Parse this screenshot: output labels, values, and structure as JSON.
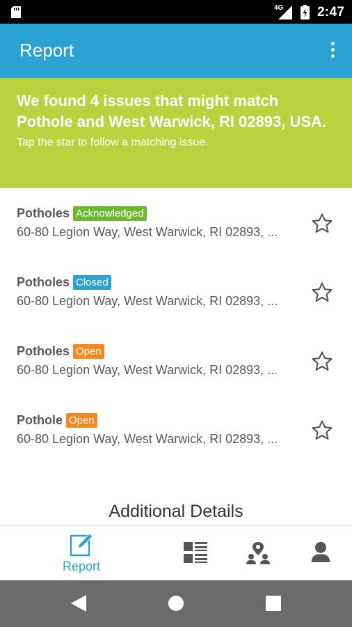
{
  "status_bar": {
    "network": "4G",
    "time": "2:47"
  },
  "app_bar": {
    "title": "Report"
  },
  "banner": {
    "headline": "We found 4 issues that might match Pothole and West Warwick, RI 02893, USA.",
    "subtext": "Tap the star to follow a matching issue."
  },
  "issues": [
    {
      "category": "Potholes",
      "status": "Acknowledged",
      "status_color": "#6cb82e",
      "address": "60-80 Legion Way, West Warwick, RI 02893, ..."
    },
    {
      "category": "Potholes",
      "status": "Closed",
      "status_color": "#2aa3d4",
      "address": "60-80 Legion Way, West Warwick, RI 02893, ..."
    },
    {
      "category": "Potholes",
      "status": "Open",
      "status_color": "#f5891f",
      "address": "60-80 Legion Way, West Warwick, RI 02893, ..."
    },
    {
      "category": "Pothole",
      "status": "Open",
      "status_color": "#f5891f",
      "address": "60-80 Legion Way, West Warwick, RI 02893, ..."
    }
  ],
  "additional_details": "Additional Details",
  "bottom_nav": {
    "report_label": "Report",
    "icons": [
      "edit-icon",
      "list-icon",
      "community-icon",
      "profile-icon"
    ]
  },
  "colors": {
    "primary": "#2aa3d4",
    "banner": "#b8d33f",
    "text": "#595959"
  }
}
